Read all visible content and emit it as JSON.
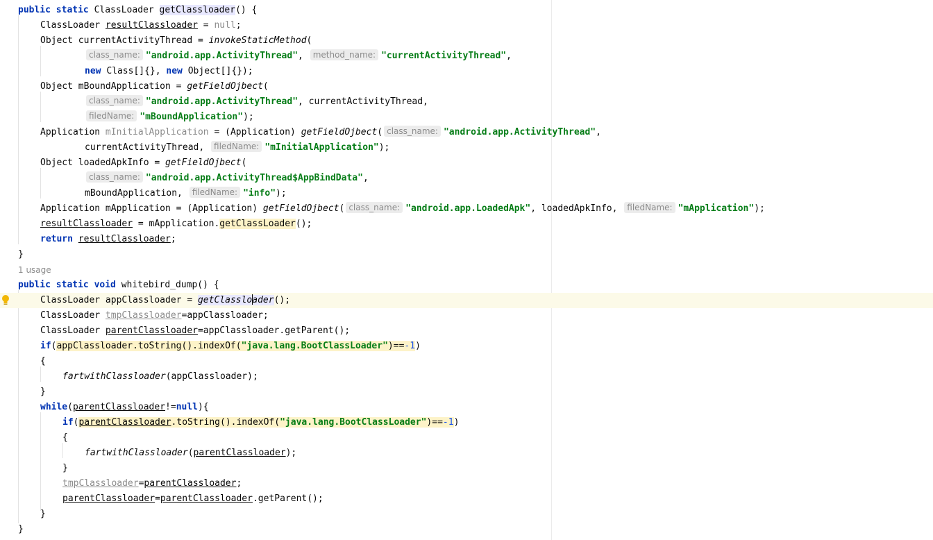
{
  "editor": {
    "usage_hint": "1 usage",
    "hints": {
      "class_name": "class_name:",
      "method_name": "method_name:",
      "filedName": "filedName:"
    },
    "strings": {
      "activity_thread": "\"android.app.ActivityThread\"",
      "current_activity_thread": "\"currentActivityThread\"",
      "m_bound_application": "\"mBoundApplication\"",
      "m_initial_application": "\"mInitialApplication\"",
      "app_bind_data": "\"android.app.ActivityThread$AppBindData\"",
      "info": "\"info\"",
      "loaded_apk": "\"android.app.LoadedApk\"",
      "m_application": "\"mApplication\"",
      "boot_class_loader": "\"java.lang.BootClassLoader\""
    },
    "colors": {
      "keyword": "#0033b3",
      "string": "#067d17",
      "number": "#1750eb",
      "hint_background": "#ececec",
      "highlight": "#fdf3c8",
      "current_line": "#fcfae8"
    },
    "icons": {
      "gutter": "lightbulb-icon"
    }
  }
}
